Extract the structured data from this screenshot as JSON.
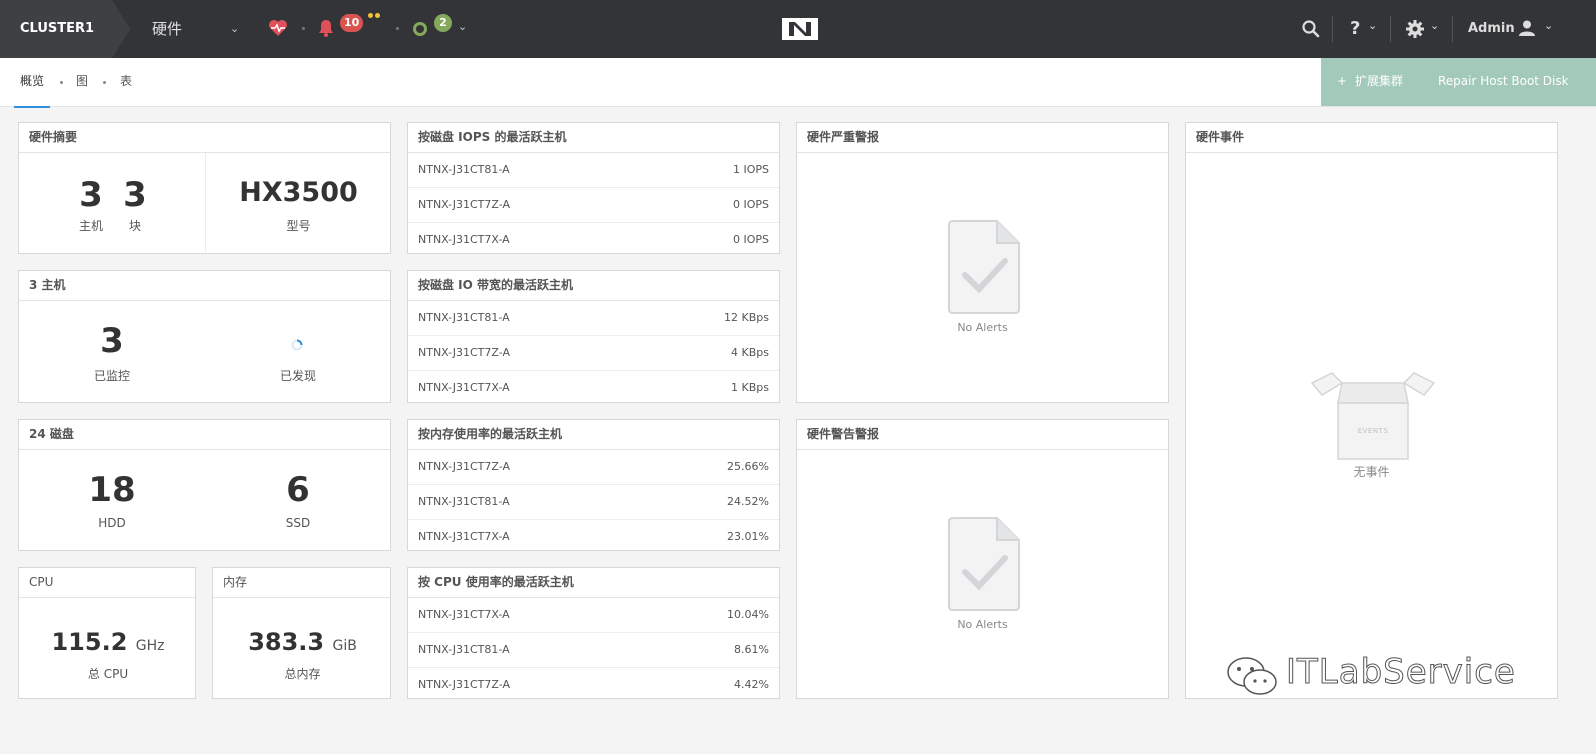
{
  "topbar": {
    "cluster_name": "CLUSTER1",
    "module": "硬件",
    "alerts_count": "10",
    "tasks_count": "2",
    "user": "Admin",
    "colors": {
      "bar": "#333437",
      "alert_badge": "#d9534f",
      "task_badge": "#86a85a",
      "health": "#e0505b"
    }
  },
  "subnav": {
    "tabs": [
      "概览",
      "图",
      "表"
    ],
    "expand_button": "扩展集群",
    "repair_button": "Repair Host Boot Disk"
  },
  "hw_summary": {
    "title": "硬件摘要",
    "hosts": "3",
    "hosts_label": "主机",
    "blocks": "3",
    "blocks_label": "块",
    "model": "HX3500",
    "model_label": "型号"
  },
  "hosts_card": {
    "title": "3 主机",
    "monitored": "3",
    "monitored_label": "已监控",
    "discovered_label": "已发现"
  },
  "disks_card": {
    "title": "24 磁盘",
    "hdd": "18",
    "hdd_label": "HDD",
    "ssd": "6",
    "ssd_label": "SSD"
  },
  "cpu_card": {
    "title": "CPU",
    "value": "115.2",
    "unit": "GHz",
    "label": "总 CPU"
  },
  "mem_card": {
    "title": "内存",
    "value": "383.3",
    "unit": "GiB",
    "label": "总内存"
  },
  "iops_card": {
    "title": "按磁盘 IOPS 的最活跃主机",
    "rows": [
      {
        "host": "NTNX-J31CT81-A",
        "value": "1 IOPS"
      },
      {
        "host": "NTNX-J31CT7Z-A",
        "value": "0 IOPS"
      },
      {
        "host": "NTNX-J31CT7X-A",
        "value": "0 IOPS"
      }
    ]
  },
  "bw_card": {
    "title": "按磁盘 IO 带宽的最活跃主机",
    "rows": [
      {
        "host": "NTNX-J31CT81-A",
        "value": "12 KBps"
      },
      {
        "host": "NTNX-J31CT7Z-A",
        "value": "4 KBps"
      },
      {
        "host": "NTNX-J31CT7X-A",
        "value": "1 KBps"
      }
    ]
  },
  "memuse_card": {
    "title": "按内存使用率的最活跃主机",
    "rows": [
      {
        "host": "NTNX-J31CT7Z-A",
        "value": "25.66%"
      },
      {
        "host": "NTNX-J31CT81-A",
        "value": "24.52%"
      },
      {
        "host": "NTNX-J31CT7X-A",
        "value": "23.01%"
      }
    ]
  },
  "cpuuse_card": {
    "title": "按 CPU 使用率的最活跃主机",
    "rows": [
      {
        "host": "NTNX-J31CT7X-A",
        "value": "10.04%"
      },
      {
        "host": "NTNX-J31CT81-A",
        "value": "8.61%"
      },
      {
        "host": "NTNX-J31CT7Z-A",
        "value": "4.42%"
      }
    ]
  },
  "critical_card": {
    "title": "硬件严重警报",
    "empty": "No Alerts"
  },
  "warning_card": {
    "title": "硬件警告警报",
    "empty": "No Alerts"
  },
  "events_card": {
    "title": "硬件事件",
    "box_label": "EVENTS",
    "empty": "无事件"
  },
  "watermark": "ITLabService"
}
